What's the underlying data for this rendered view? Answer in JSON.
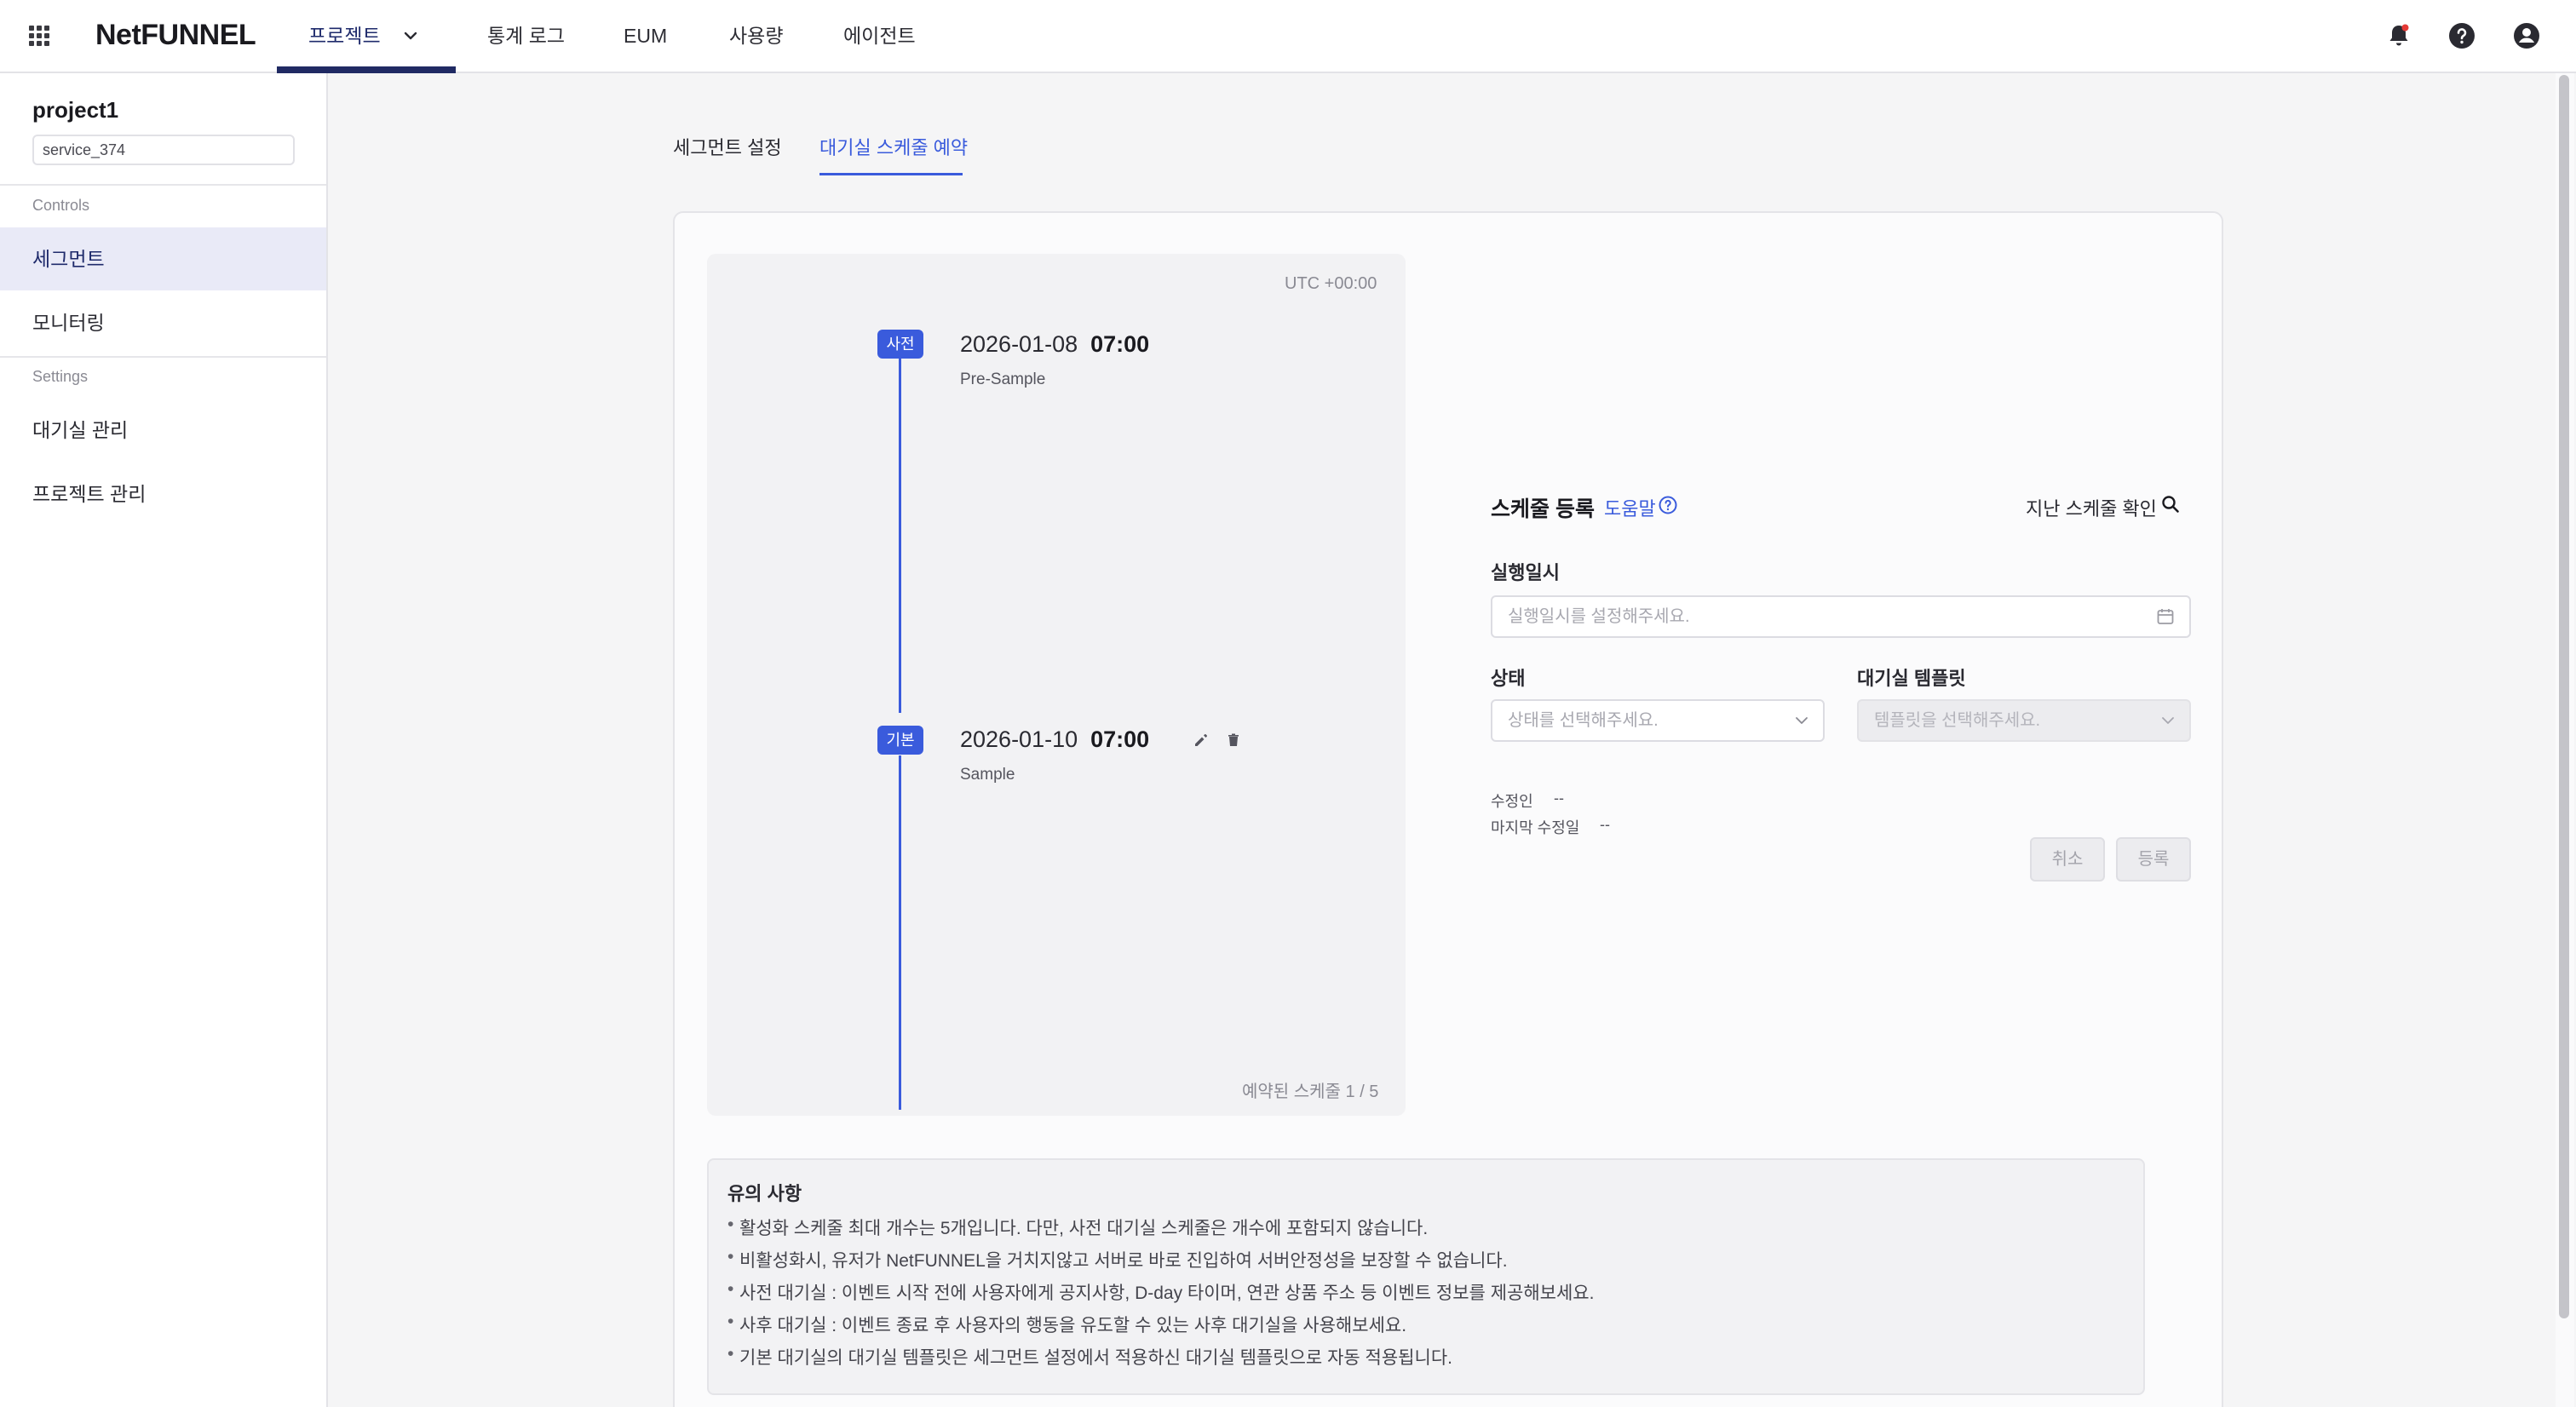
{
  "header": {
    "logo": "NetFUNNEL",
    "nav": [
      {
        "label": "프로젝트",
        "active": true
      },
      {
        "label": "통계 로그"
      },
      {
        "label": "EUM"
      },
      {
        "label": "사용량"
      },
      {
        "label": "에이전트"
      }
    ],
    "icons": [
      "apps-grid-icon",
      "bell-icon",
      "help-icon",
      "account-icon"
    ]
  },
  "sidebar": {
    "project_name": "project1",
    "service": "service_374",
    "sections": [
      {
        "title": "Controls",
        "items": [
          "세그먼트",
          "모니터링"
        ]
      },
      {
        "title": "Settings",
        "items": [
          "대기실 관리",
          "프로젝트 관리"
        ]
      }
    ],
    "active_item": "세그먼트"
  },
  "tabs": [
    {
      "label": "세그먼트 설정"
    },
    {
      "label": "대기실 스케줄 예약",
      "active": true
    }
  ],
  "timeline": {
    "timezone": "UTC +00:00",
    "entries": [
      {
        "badge": "사전",
        "date": "2026-01-08",
        "time": "07:00",
        "name": "Pre-Sample"
      },
      {
        "badge": "기본",
        "date": "2026-01-10",
        "time": "07:00",
        "name": "Sample"
      }
    ],
    "reserved_count": "예약된 스케줄  1 / 5"
  },
  "form": {
    "title": "스케줄 등록",
    "help": "도움말",
    "past": "지난 스케줄 확인",
    "datetime_label": "실행일시",
    "datetime_placeholder": "실행일시를 설정해주세요.",
    "status_label": "상태",
    "status_placeholder": "상태를 선택해주세요.",
    "template_label": "대기실 템플릿",
    "template_placeholder": "템플릿을 선택해주세요.",
    "modifier_label": "수정인",
    "modifier_value": "--",
    "modified_label": "마지막 수정일",
    "modified_value": "--",
    "cancel": "취소",
    "register": "등록"
  },
  "notes": {
    "title": "유의 사항",
    "items": [
      "활성화 스케줄 최대 개수는 5개입니다. 다만, 사전 대기실 스케줄은 개수에 포함되지 않습니다.",
      "비활성화시, 유저가 NetFUNNEL을 거치지않고 서버로 바로 진입하여 서버안정성을 보장할 수 없습니다.",
      "사전 대기실 : 이벤트 시작 전에 사용자에게 공지사항, D-day 타이머, 연관 상품 주소 등 이벤트 정보를 제공해보세요.",
      "사후 대기실 : 이벤트 종료 후 사용자의 행동을 유도할 수 있는 사후 대기실을 사용해보세요.",
      "기본 대기실의 대기실 템플릿은 세그먼트 설정에서 적용하신 대기실 템플릿으로 자동 적용됩니다."
    ]
  },
  "colors": {
    "accent": "#3a5bdc",
    "nav_active": "#202a63",
    "sidebar_active_bg": "#e9eaf7"
  }
}
